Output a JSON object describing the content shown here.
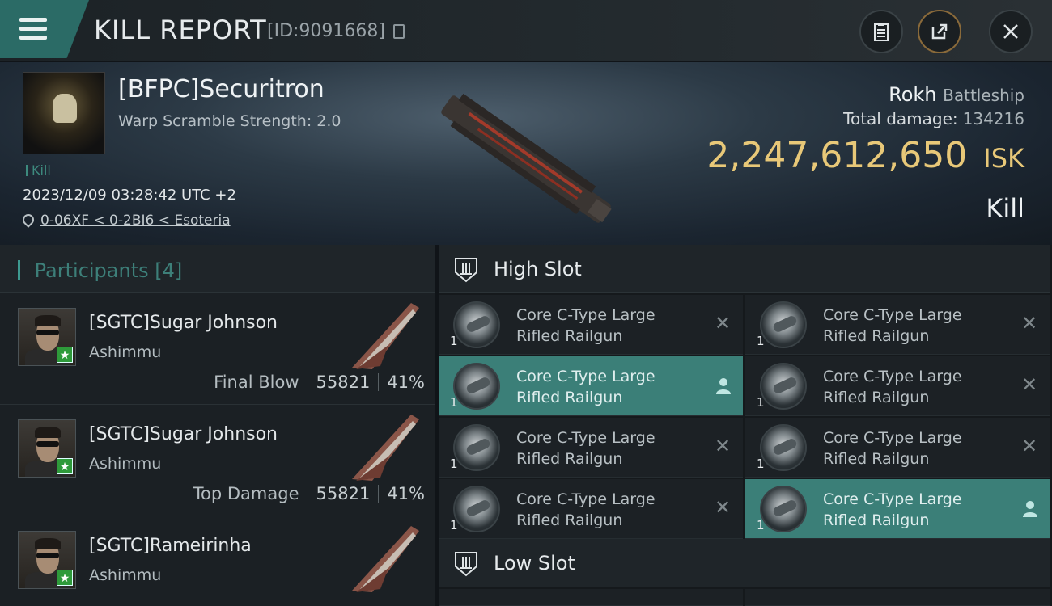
{
  "header": {
    "title": "KILL REPORT",
    "report_id": "[ID:9091668]"
  },
  "victim": {
    "name": "[BFPC]Securitron",
    "subtitle": "Warp Scramble Strength: 2.0",
    "tag": "Kill",
    "timestamp": "2023/12/09 03:28:42 UTC +2",
    "location": "0-06XF < 0-2BI6 < Esoteria",
    "ship": "Rokh",
    "ship_class": "Battleship",
    "total_damage_label": "Total damage:",
    "total_damage": "134216",
    "isk_value": "2,247,612,650",
    "isk_unit": "ISK",
    "result": "Kill"
  },
  "participants": {
    "label": "Participants",
    "count": "[4]",
    "items": [
      {
        "name": "[SGTC]Sugar Johnson",
        "ship": "Ashimmu",
        "role": "Final Blow",
        "damage": "55821",
        "percent": "41%"
      },
      {
        "name": "[SGTC]Sugar Johnson",
        "ship": "Ashimmu",
        "role": "Top Damage",
        "damage": "55821",
        "percent": "41%"
      },
      {
        "name": "[SGTC]Rameirinha",
        "ship": "Ashimmu"
      }
    ]
  },
  "high_slot": {
    "label": "High Slot",
    "modules": [
      {
        "line1": "Core C-Type Large",
        "line2": "Rifled Railgun",
        "qty": "1",
        "state": "destroyed"
      },
      {
        "line1": "Core C-Type Large",
        "line2": "Rifled Railgun",
        "qty": "1",
        "state": "destroyed"
      },
      {
        "line1": "Core C-Type Large",
        "line2": "Rifled Railgun",
        "qty": "1",
        "state": "dropped"
      },
      {
        "line1": "Core C-Type Large",
        "line2": "Rifled Railgun",
        "qty": "1",
        "state": "destroyed"
      },
      {
        "line1": "Core C-Type Large",
        "line2": "Rifled Railgun",
        "qty": "1",
        "state": "destroyed"
      },
      {
        "line1": "Core C-Type Large",
        "line2": "Rifled Railgun",
        "qty": "1",
        "state": "destroyed"
      },
      {
        "line1": "Core C-Type Large",
        "line2": "Rifled Railgun",
        "qty": "1",
        "state": "destroyed"
      },
      {
        "line1": "Core C-Type Large",
        "line2": "Rifled Railgun",
        "qty": "1",
        "state": "dropped"
      }
    ]
  },
  "low_slot": {
    "label": "Low Slot"
  },
  "colors": {
    "accent": "#3b7f78",
    "isk": "#e8c878"
  }
}
